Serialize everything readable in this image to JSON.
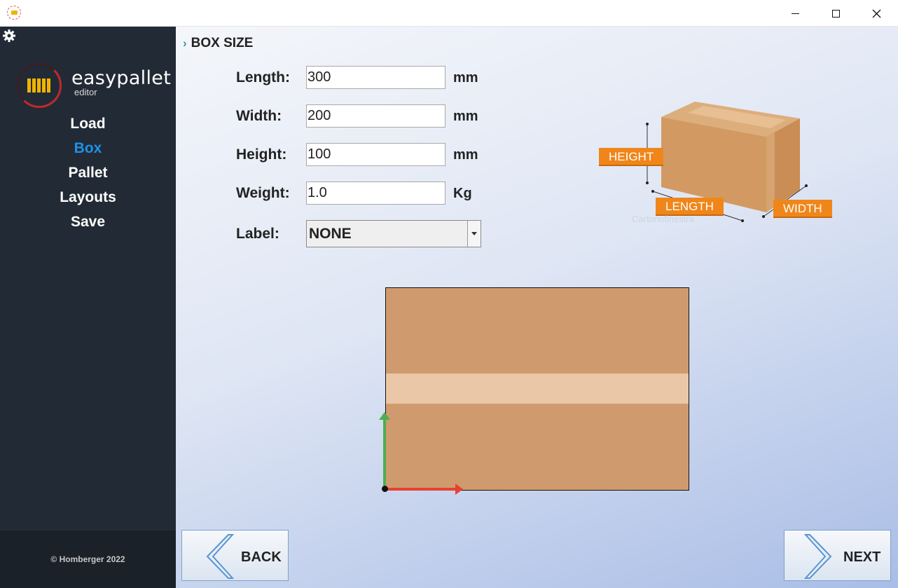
{
  "window": {
    "icon": "easypallet-icon",
    "controls": {
      "minimize": "minimize-icon",
      "maximize": "maximize-icon",
      "close": "close-icon"
    }
  },
  "sidebar": {
    "settings_icon": "gear-icon",
    "logo": {
      "name": "easypallet",
      "sub": "editor"
    },
    "items": [
      {
        "label": "Load",
        "active": false
      },
      {
        "label": "Box",
        "active": true
      },
      {
        "label": "Pallet",
        "active": false
      },
      {
        "label": "Layouts",
        "active": false
      },
      {
        "label": "Save",
        "active": false
      }
    ],
    "footer": "© Homberger 2022",
    "active_color": "#1e90e8"
  },
  "main": {
    "section_title": "BOX SIZE",
    "fields": {
      "length": {
        "label": "Length:",
        "value": "300",
        "unit": "mm"
      },
      "width": {
        "label": "Width:",
        "value": "200",
        "unit": "mm"
      },
      "height": {
        "label": "Height:",
        "value": "100",
        "unit": "mm"
      },
      "weight": {
        "label": "Weight:",
        "value": "1.0",
        "unit": "Kg"
      },
      "label": {
        "label": "Label:",
        "value": "NONE"
      }
    },
    "illustration": {
      "height_tag": "HEIGHT",
      "length_tag": "LENGTH",
      "width_tag": "WIDTH",
      "watermark": "Cartonofinestra"
    },
    "preview": {
      "box_color": "#cf9b6e",
      "tape_color": "#eac7a6",
      "x_axis_color": "#e8402f",
      "y_axis_color": "#4caf50"
    },
    "buttons": {
      "back": "BACK",
      "next": "NEXT"
    }
  }
}
